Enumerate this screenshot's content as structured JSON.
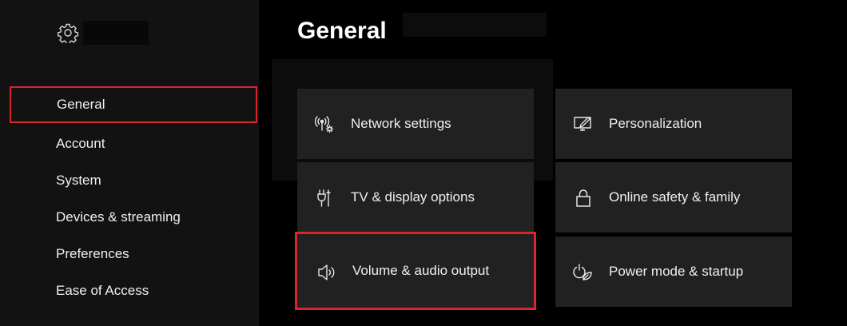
{
  "colors": {
    "accent_red": "#d9252b",
    "sidebar_bg": "#121212",
    "tile_bg": "#212121",
    "text": "#f0f0f0"
  },
  "header": {
    "settings_icon": "gear-icon"
  },
  "sidebar": {
    "items": [
      {
        "label": "General",
        "selected": true
      },
      {
        "label": "Account",
        "selected": false
      },
      {
        "label": "System",
        "selected": false
      },
      {
        "label": "Devices & streaming",
        "selected": false
      },
      {
        "label": "Preferences",
        "selected": false
      },
      {
        "label": "Ease of Access",
        "selected": false
      }
    ]
  },
  "main": {
    "title": "General",
    "tiles": [
      {
        "label": "Network settings",
        "icon": "network-icon",
        "selected": false
      },
      {
        "label": "Personalization",
        "icon": "personalization-icon",
        "selected": false
      },
      {
        "label": "TV & display options",
        "icon": "plug-icon",
        "selected": false
      },
      {
        "label": "Online safety & family",
        "icon": "lock-icon",
        "selected": false
      },
      {
        "label": "Volume & audio output",
        "icon": "speaker-icon",
        "selected": true
      },
      {
        "label": "Power mode & startup",
        "icon": "power-leaf-icon",
        "selected": false
      }
    ]
  }
}
